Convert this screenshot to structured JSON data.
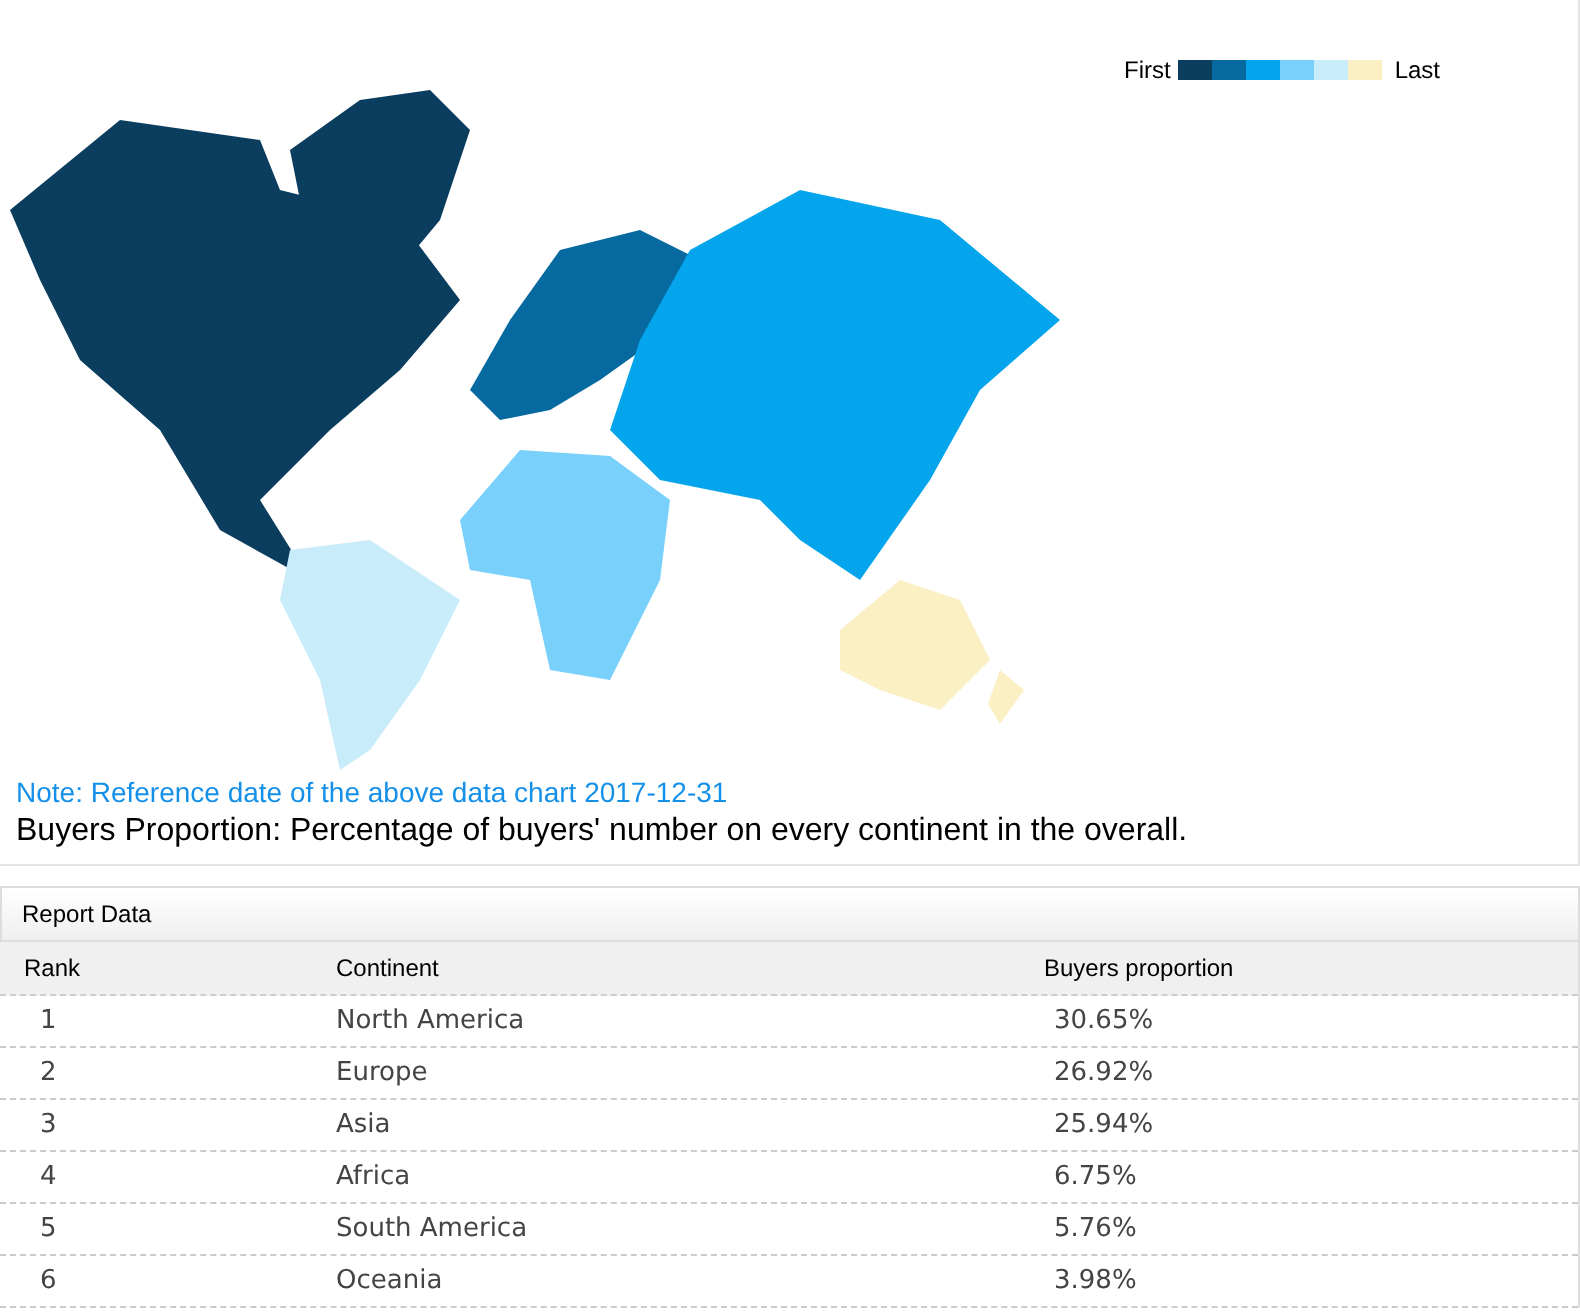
{
  "legend": {
    "first_label": "First",
    "last_label": "Last",
    "swatches": [
      {
        "color": "#0a3d5e"
      },
      {
        "color": "#06699f"
      },
      {
        "color": "#04a5ec"
      },
      {
        "color": "#78d0fb"
      },
      {
        "color": "#c9ecfb"
      },
      {
        "color": "#fbefc4"
      }
    ]
  },
  "map": {
    "regions": [
      {
        "color": "#0a3d5e"
      },
      {
        "color": "#06699f"
      },
      {
        "color": "#04a5ec"
      },
      {
        "color": "#78d0fb"
      },
      {
        "color": "#c9ecfb"
      },
      {
        "color": "#fbefc4"
      }
    ]
  },
  "note": "Note: Reference date of the above data chart 2017-12-31",
  "caption": "Buyers Proportion: Percentage of buyers' number on every continent in the overall.",
  "report": {
    "title": "Report Data",
    "columns": [
      "Rank",
      "Continent",
      "Buyers proportion"
    ],
    "rows": [
      [
        "1",
        "North America",
        "30.65%"
      ],
      [
        "2",
        "Europe",
        "26.92%"
      ],
      [
        "3",
        "Asia",
        "25.94%"
      ],
      [
        "4",
        "Africa",
        "6.75%"
      ],
      [
        "5",
        "South America",
        "5.76%"
      ],
      [
        "6",
        "Oceania",
        "3.98%"
      ]
    ]
  }
}
